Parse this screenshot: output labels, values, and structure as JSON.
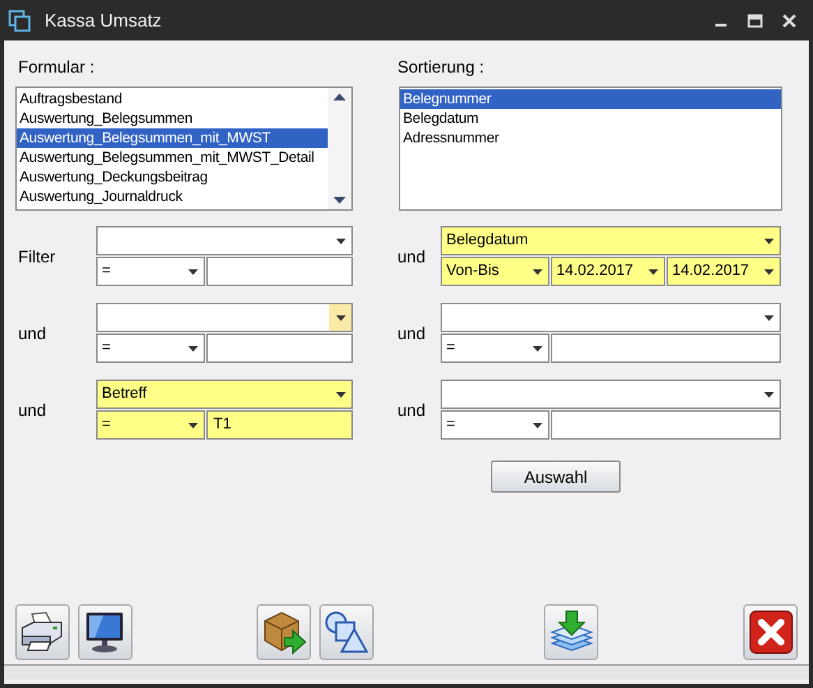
{
  "window": {
    "title": "Kassa Umsatz",
    "controls": [
      {
        "kind": "minimize"
      },
      {
        "kind": "maximize"
      },
      {
        "kind": "close"
      }
    ]
  },
  "formular": {
    "label": "Formular :",
    "items": [
      {
        "text": "Auftragsbestand",
        "selected": false
      },
      {
        "text": "Auswertung_Belegsummen",
        "selected": false
      },
      {
        "text": "Auswertung_Belegsummen_mit_MWST",
        "selected": true
      },
      {
        "text": "Auswertung_Belegsummen_mit_MWST_Detail",
        "selected": false
      },
      {
        "text": "Auswertung_Deckungsbeitrag",
        "selected": false
      },
      {
        "text": "Auswertung_Journaldruck",
        "selected": false
      }
    ]
  },
  "sortierung": {
    "label": "Sortierung :",
    "items": [
      {
        "text": "Belegnummer",
        "selected": true
      },
      {
        "text": "Belegdatum",
        "selected": false
      },
      {
        "text": "Adressnummer",
        "selected": false
      }
    ]
  },
  "filters_left": [
    {
      "label": "Filter",
      "kind": "simple",
      "highlighted": false,
      "button_hover": false,
      "operator": "="
    },
    {
      "label": "und",
      "kind": "simple",
      "highlighted": false,
      "button_hover": true,
      "operator": "="
    },
    {
      "label": "und",
      "kind": "simple",
      "field": "Betreff",
      "highlighted": true,
      "button_hover": false,
      "operator": "=",
      "value": "T1"
    }
  ],
  "filters_right": [
    {
      "label": "und",
      "kind": "range",
      "field": "Belegdatum",
      "highlighted": true,
      "button_hover": false,
      "operator": "Von-Bis",
      "from": "14.02.2017",
      "to": "14.02.2017"
    },
    {
      "label": "und",
      "kind": "simple",
      "highlighted": false,
      "button_hover": false,
      "operator": "="
    },
    {
      "label": "und",
      "kind": "simple",
      "highlighted": false,
      "button_hover": false,
      "operator": "="
    }
  ],
  "select_button": "Auswahl",
  "toolbar": [
    {
      "kind": "print"
    },
    {
      "kind": "screen"
    },
    {
      "kind": "spacer"
    },
    {
      "kind": "export"
    },
    {
      "kind": "shapes"
    },
    {
      "kind": "spacer"
    },
    {
      "kind": "import"
    },
    {
      "kind": "spacer"
    },
    {
      "kind": "close"
    }
  ]
}
